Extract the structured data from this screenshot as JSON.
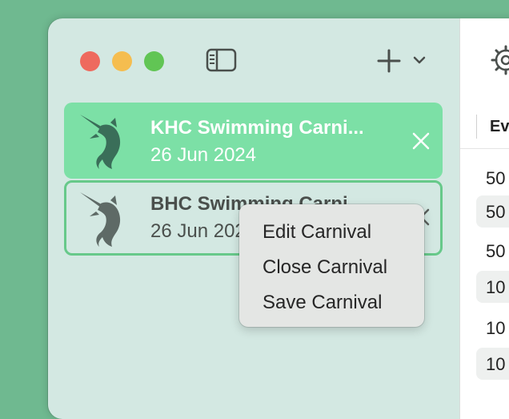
{
  "window": {
    "toolbar": {
      "traffic_lights": [
        "close",
        "minimize",
        "maximize"
      ],
      "icons": [
        "sidebar-toggle-icon",
        "plus-icon",
        "chevron-down-icon"
      ]
    },
    "carnivals": [
      {
        "title": "KHC Swimming Carni...",
        "date": "26 Jun 2024",
        "selected": true,
        "icon": "swordfish-icon"
      },
      {
        "title": "BHC Swimming Carni...",
        "date": "26 Jun 2024",
        "selected": false,
        "icon": "swordfish-icon"
      }
    ],
    "detail": {
      "icon": "gear-icon",
      "column_header": "Ev",
      "rows": [
        "50",
        "50",
        "50",
        "10",
        "10",
        "10"
      ]
    }
  },
  "context_menu": {
    "items": [
      "Edit Carnival",
      "Close Carnival",
      "Save Carnival"
    ]
  },
  "colors": {
    "desktop": "#6fb990",
    "sidebar": "#d3e8e2",
    "selected_card": "#7ce0a6",
    "card_border": "#67c98a",
    "fish_selected": "#3a6e59",
    "fish_normal": "#5e6a66"
  }
}
